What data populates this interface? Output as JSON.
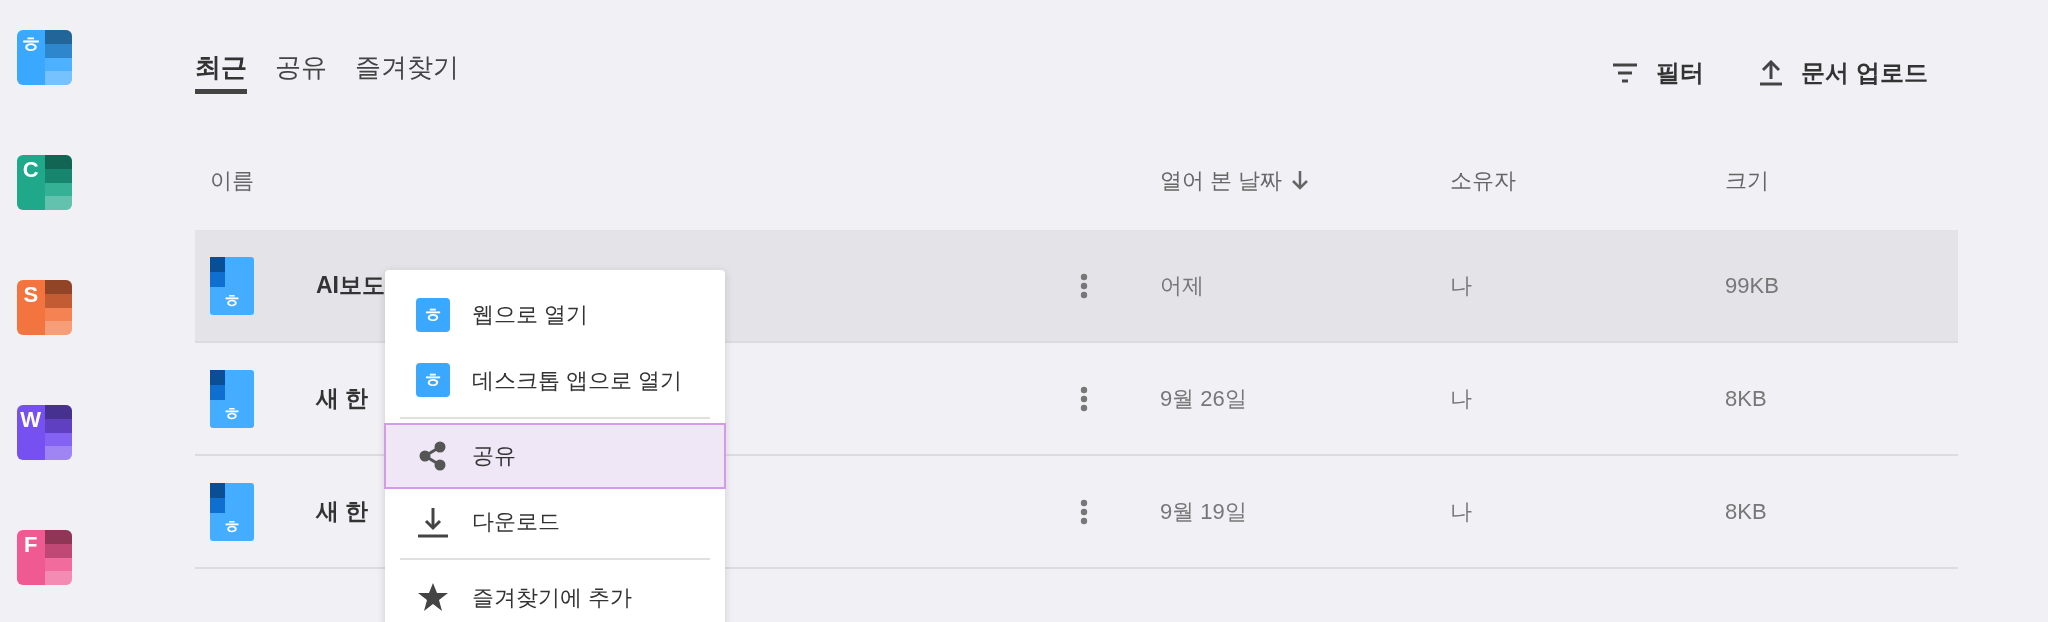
{
  "sidebar": {
    "apps": [
      {
        "letter": "ㅎ",
        "color": "#3aa8ff"
      },
      {
        "letter": "C",
        "color": "#1fa88a"
      },
      {
        "letter": "S",
        "color": "#f47440"
      },
      {
        "letter": "W",
        "color": "#7650f0"
      },
      {
        "letter": "F",
        "color": "#ef5a92"
      }
    ]
  },
  "tabs": [
    {
      "label": "최근",
      "selected": true
    },
    {
      "label": "공유",
      "selected": false
    },
    {
      "label": "즐겨찾기",
      "selected": false
    }
  ],
  "toolbar": [
    {
      "kind": "filter",
      "label": "필터"
    },
    {
      "kind": "upload",
      "label": "문서 업로드"
    }
  ],
  "table": {
    "columns": [
      {
        "label": "이름",
        "sorted": false
      },
      {
        "label": "열어 본 날짜",
        "sorted": true
      },
      {
        "label": "소유자",
        "sorted": false
      },
      {
        "label": "크기",
        "sorted": false
      }
    ],
    "rows": [
      {
        "icon_letter": "ㅎ",
        "name": "AI보도",
        "opened": "어제",
        "owner": "나",
        "size": "99KB",
        "selected": true
      },
      {
        "icon_letter": "ㅎ",
        "name": "새 한",
        "opened": "9월 26일",
        "owner": "나",
        "size": "8KB",
        "selected": false
      },
      {
        "icon_letter": "ㅎ",
        "name": "새 한",
        "opened": "9월 19일",
        "owner": "나",
        "size": "8KB",
        "selected": false
      }
    ]
  },
  "context_menu": {
    "items": [
      {
        "kind": "app",
        "icon_letter": "ㅎ",
        "label": "웹으로 열기",
        "selected": false
      },
      {
        "kind": "app",
        "icon_letter": "ㅎ",
        "label": "데스크톱 앱으로 열기",
        "selected": false
      },
      {
        "kind": "divider"
      },
      {
        "kind": "share",
        "label": "공유",
        "selected": true
      },
      {
        "kind": "download",
        "label": "다운로드",
        "selected": false
      },
      {
        "kind": "divider"
      },
      {
        "kind": "star",
        "label": "즐겨찾기에 추가",
        "selected": false
      }
    ]
  }
}
